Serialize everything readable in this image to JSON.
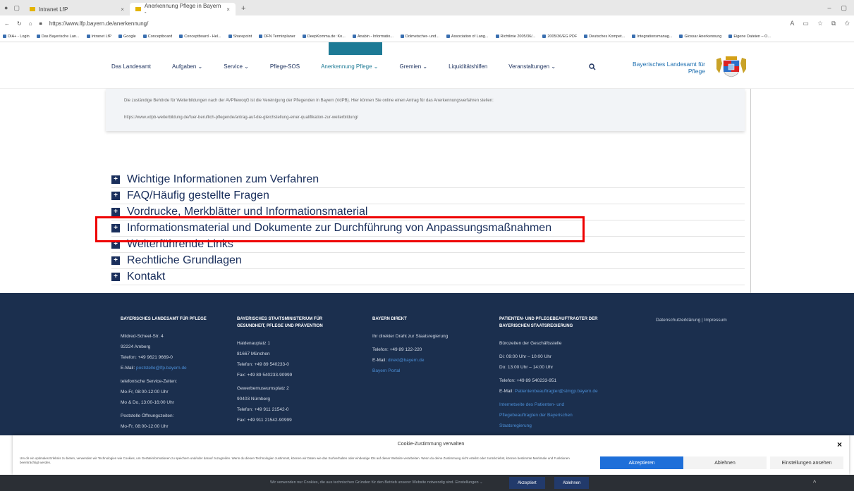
{
  "browser": {
    "tabs": [
      {
        "title": "Intranet LfP",
        "active": false
      },
      {
        "title": "Anerkennung Pflege in Bayern -",
        "active": true
      }
    ],
    "new_tab": "+",
    "url": "https://www.lfp.bayern.de/anerkennung/",
    "bookmarks": [
      "DIA+ - Login",
      "Das Bayerische Lan...",
      "Intranet LfP",
      "Google",
      "Conceptboard",
      "Conceptboard - Hel...",
      "Sharepoint",
      "DFN Terminplaner",
      "DeepKomma.de: Ko...",
      "Anabin - Informatio...",
      "Dolmetscher- und...",
      "Association of Lang...",
      "Richtlinie 2005/36/...",
      "2005/36/EG PDF",
      "Deutsches Kompet...",
      "Integrationsmanag...",
      "Glossar Anerkennung",
      "Eigene Dateien – O..."
    ]
  },
  "header": {
    "nav": [
      {
        "label": "Das Landesamt",
        "active": false
      },
      {
        "label": "Aufgaben ⌄",
        "active": false
      },
      {
        "label": "Service ⌄",
        "active": false
      },
      {
        "label": "Pflege-SOS",
        "active": false
      },
      {
        "label": "Anerkennung Pflege ⌄",
        "active": true
      },
      {
        "label": "Gremien ⌄",
        "active": false
      },
      {
        "label": "Liquiditätshilfen",
        "active": false
      },
      {
        "label": "Veranstaltungen ⌄",
        "active": false
      }
    ],
    "brand_line1": "Bayerisches Landesamt für",
    "brand_line2": "Pflege"
  },
  "infobox": {
    "text": "Die zuständige Behörde für Weiterbildungen nach der AVPflewoqG ist die Vereinigung der Pflegenden in Bayern (VdPB). Hier können Sie online einen Antrag für das Anerkennungsverfahren stellen:",
    "link": "https://www.vdpb-weiterbildung.de/fuer-beruflich-pflegende/antrag-auf-die-gleichstellung-einer-qualifikation-zur-weiterbildung/"
  },
  "accordion": [
    "Wichtige Informationen zum Verfahren",
    "FAQ/Häufig gestellte Fragen",
    "Vordrucke, Merkblätter und Informationsmaterial",
    "Informationsmaterial und Dokumente zur Durchführung von Anpassungsmaßnahmen",
    "Weiterführende Links",
    "Rechtliche Grundlagen",
    "Kontakt"
  ],
  "footer": {
    "col1": {
      "heading": "BAYERISCHES LANDESAMT FÜR PFLEGE",
      "lines": [
        "Mildred-Scheel-Str. 4",
        "92224 Amberg",
        "Telefon: +49 9621 9669-0"
      ],
      "email_label": "E-Mail: ",
      "email": "poststelle@lfp.bayern.de",
      "lines2": [
        "telefonische Service-Zeiten:",
        "Mo-Fr, 08:00-12:00 Uhr",
        "Mo & Do, 13:00-16:00 Uhr"
      ],
      "lines3": [
        "Poststelle Öffnungszeiten:",
        "Mo-Fr, 08:00-12:00 Uhr"
      ]
    },
    "col2": {
      "heading1": "BAYERISCHES STAATSMINISTERIUM FÜR",
      "heading2": "GESUNDHEIT, PFLEGE UND PRÄVENTION",
      "lines": [
        "Haidenauplatz 1",
        "81667 München",
        "Telefon: +49 89 540233-0",
        "Fax: +49 89 540233-90999"
      ],
      "lines2": [
        "Gewerbemuseumsplatz 2",
        "90403 Nürnberg",
        "Telefon: +49 911 21542-0",
        "Fax: +49 911 21542-90999"
      ]
    },
    "col3": {
      "heading": "BAYERN DIREKT",
      "lines": [
        "Ihr direkter Draht zur Staatsregierung"
      ],
      "phone": "Telefon: +49 89 122-220",
      "email_label": "E-Mail: ",
      "email": "direkt@bayern.de",
      "portal": "Bayern Portal"
    },
    "col4": {
      "heading1": "PATIENTEN- UND PFLEGEBEAUFTRAGTER DER",
      "heading2": "BAYERISCHEN STAATSREGIERUNG",
      "lines": [
        "Bürozeiten der Geschäftsstelle"
      ],
      "lines2": [
        "Di: 09:00 Uhr – 10:00 Uhr",
        "Do: 13:00 Uhr – 14:00 Uhr"
      ],
      "phone": "Telefon: +49 89 540233-951",
      "email_label": "E-Mail: ",
      "email": "Patientenbeauftragter@stmgp.bayern.de",
      "link_lines": [
        "Internetseite des Patienten- und",
        "Pflegebeauftragten der Bayerischen",
        "Staatsregierung"
      ]
    },
    "legal": "Datenschutzerklärung   |   Impressum"
  },
  "cookie": {
    "title": "Cookie-Zustimmung verwalten",
    "close": "×",
    "text": "Um dir ein optimales Erlebnis zu bieten, verwenden wir Technologien wie Cookies, um Geräteinformationen zu speichern und/oder darauf zuzugreifen. Wenn du diesen Technologien zustimmst, können wir Daten wie das Surfverhalten oder eindeutige IDs auf dieser Website verarbeiten. Wenn du deine Zustimmung nicht erteilst oder zurückziehst, können bestimmte Merkmale und Funktionen beeinträchtigt werden.",
    "accept": "Akzeptieren",
    "deny": "Ablehnen",
    "settings": "Einstellungen ansehen"
  },
  "bottom_bar": {
    "text": "Wir verwenden nur Cookies, die aus technischen Gründen für den Betrieb unserer Website notwendig sind. Einstellungen ⌄",
    "accept": "Akzeptiert",
    "deny": "Ablehnen",
    "up": "^"
  }
}
